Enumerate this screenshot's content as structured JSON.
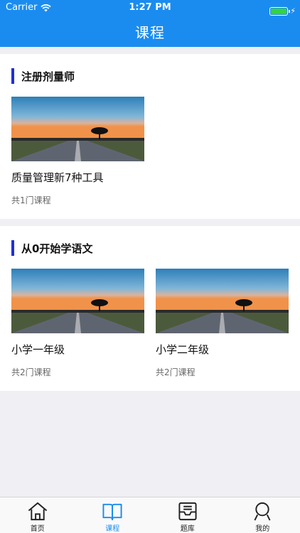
{
  "status_bar": {
    "carrier": "Carrier",
    "time": "1:27 PM"
  },
  "header": {
    "title": "课程"
  },
  "sections": [
    {
      "title": "注册剂量师",
      "courses": [
        {
          "name": "质量管理新7种工具",
          "count": "共1门课程"
        }
      ]
    },
    {
      "title": "从0开始学语文",
      "courses": [
        {
          "name": "小学一年级",
          "count": "共2门课程"
        },
        {
          "name": "小学二年级",
          "count": "共2门课程"
        }
      ]
    }
  ],
  "tabbar": {
    "items": [
      {
        "label": "首页",
        "icon": "home-icon"
      },
      {
        "label": "课程",
        "icon": "book-icon",
        "active": true
      },
      {
        "label": "题库",
        "icon": "tray-icon"
      },
      {
        "label": "我的",
        "icon": "person-icon"
      }
    ]
  },
  "colors": {
    "accent": "#1a8cf0",
    "section_bar": "#1f2fd6",
    "background": "#efeff4"
  }
}
